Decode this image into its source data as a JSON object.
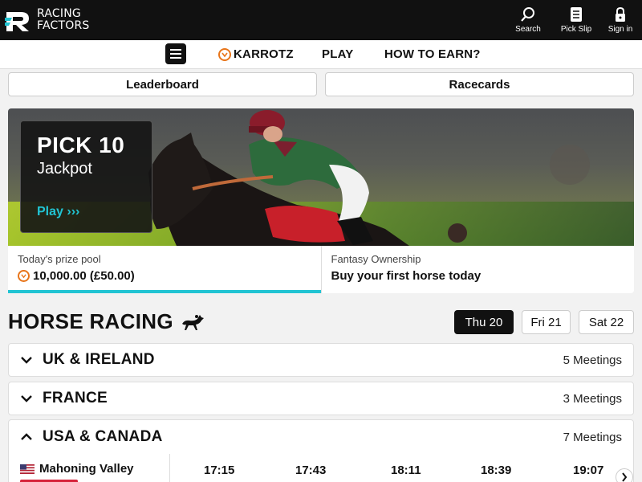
{
  "header": {
    "logo_line1": "RACING",
    "logo_line2": "FACTORS",
    "nav": [
      {
        "label": "Search",
        "icon": "search-icon"
      },
      {
        "label": "Pick Slip",
        "icon": "document-icon"
      },
      {
        "label": "Sign in",
        "icon": "lock-icon"
      }
    ]
  },
  "subnav": {
    "karrotz": "KARROTZ",
    "play": "PLAY",
    "how_to_earn": "HOW TO EARN?"
  },
  "tabs": {
    "leaderboard": "Leaderboard",
    "racecards": "Racecards"
  },
  "hero": {
    "title": "PICK 10",
    "subtitle": "Jackpot",
    "play": "Play ›››"
  },
  "prize": {
    "label": "Today's prize pool",
    "value": "10,000.00 (£50.00)",
    "fantasy_label": "Fantasy Ownership",
    "fantasy_value": "Buy your first horse today"
  },
  "racing": {
    "title": "HORSE RACING",
    "days": [
      "Thu 20",
      "Fri 21",
      "Sat 22"
    ],
    "regions": [
      {
        "name": "UK & IRELAND",
        "count": "5 Meetings"
      },
      {
        "name": "FRANCE",
        "count": "3 Meetings"
      },
      {
        "name": "USA & CANADA",
        "count": "7 Meetings"
      }
    ],
    "meeting": {
      "name": "Mahoning Valley",
      "times": [
        "17:15",
        "17:43",
        "18:11",
        "18:39",
        "19:07"
      ]
    }
  },
  "colors": {
    "accent": "#21c4d3",
    "karrotz": "#e8751a",
    "dark": "#111111"
  }
}
